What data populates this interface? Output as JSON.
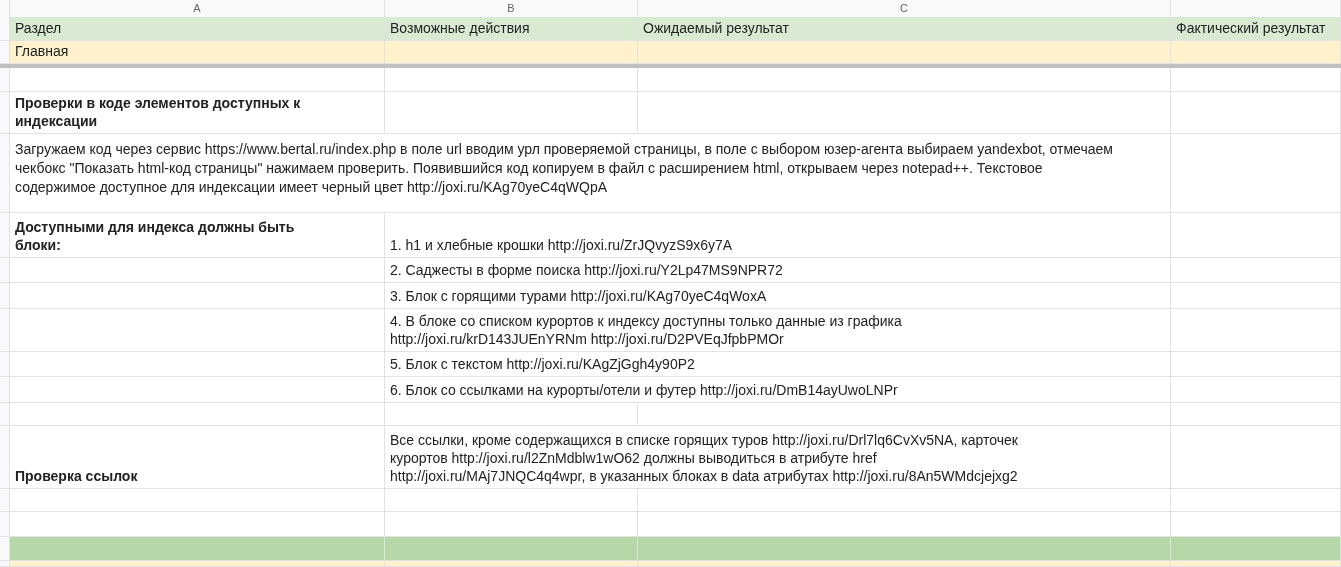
{
  "column_headers": [
    "A",
    "B",
    "C"
  ],
  "rows": [
    {
      "kind": "header",
      "a": "Раздел",
      "b": "Возможные действия",
      "c": "Ожидаемый результат",
      "d": "Фактический результат"
    },
    {
      "kind": "section",
      "a": "Главная"
    },
    {
      "kind": "blank"
    },
    {
      "kind": "heading",
      "a": "Проверки в коде элементов доступных к индексации"
    },
    {
      "kind": "note",
      "text": "Загружаем код через сервис https://www.bertal.ru/index.php в поле url вводим урл проверяемой страницы, в поле с выбором юзер-агента выбираем yandexbot, отмечаем\nчекбокс \"Показать html-код страницы\" нажимаем проверить. Появившийся код копируем в файл с расширением html, открываем через notepad++. Текстовое\nсодержимое доступное для индексации имеет черный цвет http://joxi.ru/KAg70yeC4qWQpA"
    },
    {
      "kind": "item",
      "a": "Доступными для индекса должны быть\nблоки:",
      "bc": "1. h1 и хлебные крошки http://joxi.ru/ZrJQvyzS9x6y7A"
    },
    {
      "kind": "item",
      "bc": "2. Саджесты в форме поиска http://joxi.ru/Y2Lp47MS9NPR72"
    },
    {
      "kind": "item",
      "bc": "3. Блок с горящими турами http://joxi.ru/KAg70yeC4qWoxA"
    },
    {
      "kind": "item",
      "bc": "4. В блоке со списком курортов к индексу доступны только данные из графика\nhttp://joxi.ru/krD143JUEnYRNm http://joxi.ru/D2PVEqJfpbPMOr"
    },
    {
      "kind": "item",
      "bc": "5. Блок с текстом http://joxi.ru/KAgZjGgh4y90P2"
    },
    {
      "kind": "item",
      "bc": "6. Блок со ссылками на курорты/отели и футер http://joxi.ru/DmB14ayUwoLNPr"
    },
    {
      "kind": "blank"
    },
    {
      "kind": "item",
      "a": "Проверка ссылок",
      "bc": "Все ссылки, кроме содержащихся в списке горящих туров http://joxi.ru/Drl7lq6CvXv5NA, карточек\nкурортов http://joxi.ru/l2ZnMdblw1wO62 должны выводиться в атрибуте href\nhttp://joxi.ru/MAj7JNQC4q4wpr, в указанных блоках в data атрибутах http://joxi.ru/8An5WMdcjejxg2"
    },
    {
      "kind": "blank"
    },
    {
      "kind": "blank"
    },
    {
      "kind": "band"
    },
    {
      "kind": "tail"
    }
  ]
}
